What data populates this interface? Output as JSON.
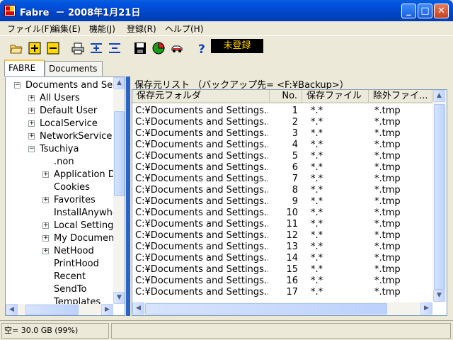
{
  "window": {
    "title": "Fabre  － 2008年1月21日"
  },
  "menu": [
    {
      "label": "ファイル(F)"
    },
    {
      "label": "編集(E)"
    },
    {
      "label": "機能(J)"
    },
    {
      "label": "登録(R)"
    },
    {
      "label": "ヘルプ(H)"
    }
  ],
  "toolbar": {
    "buttons": [
      {
        "icon": "open-folder-icon"
      },
      {
        "icon": "add-icon"
      },
      {
        "icon": "remove-icon"
      },
      {
        "icon": "print-icon"
      },
      {
        "icon": "add-row-icon"
      },
      {
        "icon": "delete-row-icon"
      },
      {
        "icon": "save-icon"
      },
      {
        "icon": "pie-chart-icon"
      },
      {
        "icon": "car-icon"
      },
      {
        "icon": "help-icon"
      }
    ],
    "registration_status": "未登録",
    "registration_color": "#ffd000"
  },
  "tabs": [
    {
      "label": "FABRE",
      "active": true
    },
    {
      "label": "Documents",
      "active": false
    }
  ],
  "tree": [
    {
      "label": "Documents and Se",
      "expander": "−"
    },
    {
      "label": "All Users",
      "expander": "+"
    },
    {
      "label": "Default User",
      "expander": "+"
    },
    {
      "label": "LocalService",
      "expander": "+"
    },
    {
      "label": "NetworkService",
      "expander": "+"
    },
    {
      "label": "Tsuchiya",
      "expander": "−"
    },
    {
      "label": ".non",
      "expander": ""
    },
    {
      "label": "Application Da",
      "expander": "+"
    },
    {
      "label": "Cookies",
      "expander": ""
    },
    {
      "label": "Favorites",
      "expander": "+"
    },
    {
      "label": "InstallAnywhe",
      "expander": ""
    },
    {
      "label": "Local Setting",
      "expander": "+"
    },
    {
      "label": "My Documen",
      "expander": "+"
    },
    {
      "label": "NetHood",
      "expander": "+"
    },
    {
      "label": "PrintHood",
      "expander": ""
    },
    {
      "label": "Recent",
      "expander": ""
    },
    {
      "label": "SendTo",
      "expander": ""
    },
    {
      "label": "Templates",
      "expander": ""
    }
  ],
  "list": {
    "caption": "保存元リスト （バックアップ先= <F:¥Backup>）",
    "columns": [
      "保存元フォルダ",
      "No.",
      "保存ファイル",
      "除外ファイ..."
    ],
    "rows": [
      {
        "folder": "C:¥Documents and Settings...",
        "no": "1",
        "files": "*.*",
        "exclude": "*.tmp"
      },
      {
        "folder": "C:¥Documents and Settings...",
        "no": "2",
        "files": "*.*",
        "exclude": "*.tmp"
      },
      {
        "folder": "C:¥Documents and Settings...",
        "no": "3",
        "files": "*.*",
        "exclude": "*.tmp"
      },
      {
        "folder": "C:¥Documents and Settings...",
        "no": "4",
        "files": "*.*",
        "exclude": "*.tmp"
      },
      {
        "folder": "C:¥Documents and Settings...",
        "no": "5",
        "files": "*.*",
        "exclude": "*.tmp"
      },
      {
        "folder": "C:¥Documents and Settings...",
        "no": "6",
        "files": "*.*",
        "exclude": "*.tmp"
      },
      {
        "folder": "C:¥Documents and Settings...",
        "no": "7",
        "files": "*.*",
        "exclude": "*.tmp"
      },
      {
        "folder": "C:¥Documents and Settings...",
        "no": "8",
        "files": "*.*",
        "exclude": "*.tmp"
      },
      {
        "folder": "C:¥Documents and Settings...",
        "no": "9",
        "files": "*.*",
        "exclude": "*.tmp"
      },
      {
        "folder": "C:¥Documents and Settings...",
        "no": "10",
        "files": "*.*",
        "exclude": "*.tmp"
      },
      {
        "folder": "C:¥Documents and Settings...",
        "no": "11",
        "files": "*.*",
        "exclude": "*.tmp"
      },
      {
        "folder": "C:¥Documents and Settings...",
        "no": "12",
        "files": "*.*",
        "exclude": "*.tmp"
      },
      {
        "folder": "C:¥Documents and Settings...",
        "no": "13",
        "files": "*.*",
        "exclude": "*.tmp"
      },
      {
        "folder": "C:¥Documents and Settings...",
        "no": "14",
        "files": "*.*",
        "exclude": "*.tmp"
      },
      {
        "folder": "C:¥Documents and Settings...",
        "no": "15",
        "files": "*.*",
        "exclude": "*.tmp"
      },
      {
        "folder": "C:¥Documents and Settings...",
        "no": "16",
        "files": "*.*",
        "exclude": "*.tmp"
      },
      {
        "folder": "C:¥Documents and Settings...",
        "no": "17",
        "files": "*.*",
        "exclude": "*.tmp"
      }
    ]
  },
  "status": {
    "free_space": "空= 30.0 GB (99%)"
  }
}
